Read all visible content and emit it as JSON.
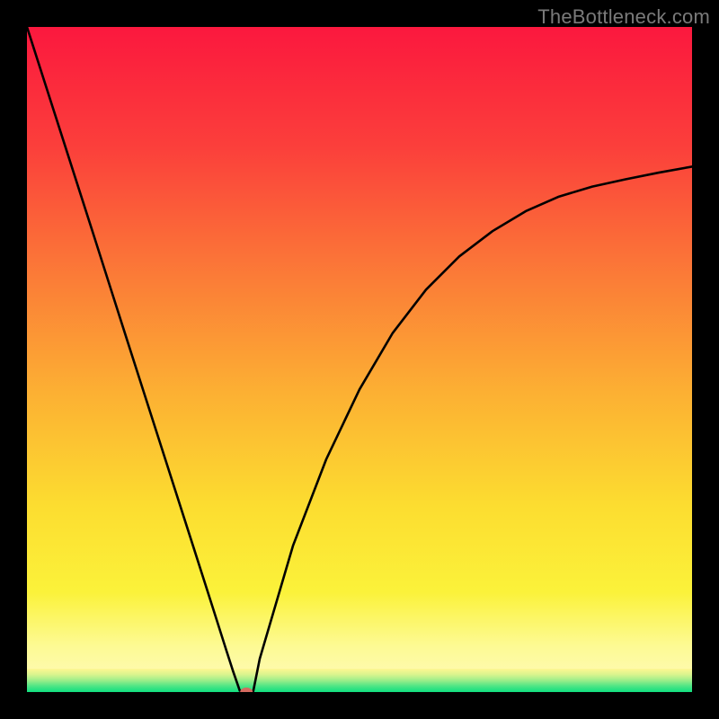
{
  "watermark": "TheBottleneck.com",
  "chart_data": {
    "type": "line",
    "title": "",
    "xlabel": "",
    "ylabel": "",
    "xlim": [
      0,
      100
    ],
    "ylim": [
      0,
      100
    ],
    "grid": false,
    "legend": false,
    "series": [
      {
        "name": "curve",
        "x": [
          0,
          5,
          10,
          15,
          20,
          25,
          28,
          30,
          31,
          32,
          33,
          34,
          35,
          40,
          45,
          50,
          55,
          60,
          65,
          70,
          75,
          80,
          85,
          90,
          95,
          100
        ],
        "y": [
          100,
          84.4,
          68.8,
          53.1,
          37.5,
          21.9,
          12.5,
          6.2,
          3.1,
          0.2,
          0.0,
          0.0,
          5.0,
          22.0,
          35.0,
          45.5,
          54.0,
          60.5,
          65.5,
          69.3,
          72.3,
          74.5,
          76.0,
          77.1,
          78.1,
          79.0
        ]
      }
    ],
    "marker": {
      "x": 33,
      "y": 0,
      "color": "#d56a5f",
      "rx": 7,
      "ry": 5
    },
    "bottom_band": {
      "from_y": 0,
      "to_y": 3.5,
      "gradient": [
        "#10e080",
        "#4ce585",
        "#9cee8a",
        "#d9f48e",
        "#fef792"
      ]
    },
    "background_gradient": {
      "direction": "vertical",
      "stops": [
        {
          "pos": 0.0,
          "color": "#fb183e"
        },
        {
          "pos": 0.18,
          "color": "#fb3f3b"
        },
        {
          "pos": 0.38,
          "color": "#fb7d37"
        },
        {
          "pos": 0.55,
          "color": "#fcb033"
        },
        {
          "pos": 0.72,
          "color": "#fcdd30"
        },
        {
          "pos": 0.85,
          "color": "#fbf23a"
        },
        {
          "pos": 0.93,
          "color": "#fdfa93"
        },
        {
          "pos": 1.0,
          "color": "#fefbc0"
        }
      ]
    }
  }
}
